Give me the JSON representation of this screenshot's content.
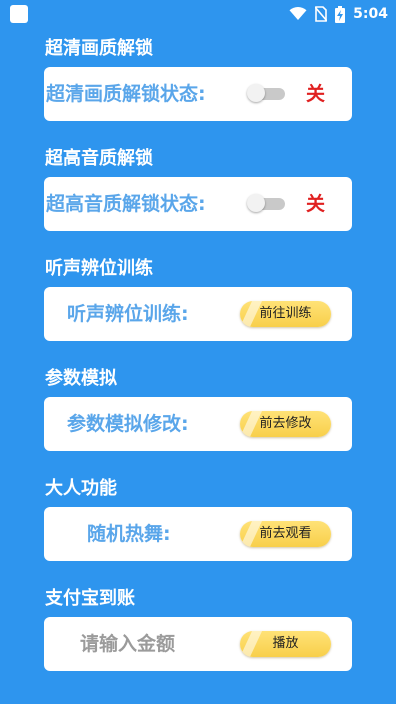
{
  "status_bar": {
    "time": "5:04",
    "icons": [
      "wifi-icon",
      "no-sim-icon",
      "battery-charging-icon"
    ]
  },
  "sections": [
    {
      "title": "超清画质解锁",
      "label": "超清画质解锁状态:",
      "control": "toggle",
      "state_text": "关",
      "toggle_on": false
    },
    {
      "title": "超高音质解锁",
      "label": "超高音质解锁状态:",
      "control": "toggle",
      "state_text": "关",
      "toggle_on": false
    },
    {
      "title": "听声辨位训练",
      "label": "听声辨位训练:",
      "control": "button",
      "button_label": "前往训练"
    },
    {
      "title": "参数模拟",
      "label": "参数模拟修改:",
      "control": "button",
      "button_label": "前去修改"
    },
    {
      "title": "大人功能",
      "label": "随机热舞:",
      "control": "button",
      "button_label": "前去观看"
    },
    {
      "title": "支付宝到账",
      "placeholder": "请输入金额",
      "control": "button",
      "button_label": "播放"
    }
  ],
  "colors": {
    "background": "#2e95ee",
    "label": "#5aa6ea",
    "off": "#e02020",
    "button": "#f8cf4a"
  }
}
